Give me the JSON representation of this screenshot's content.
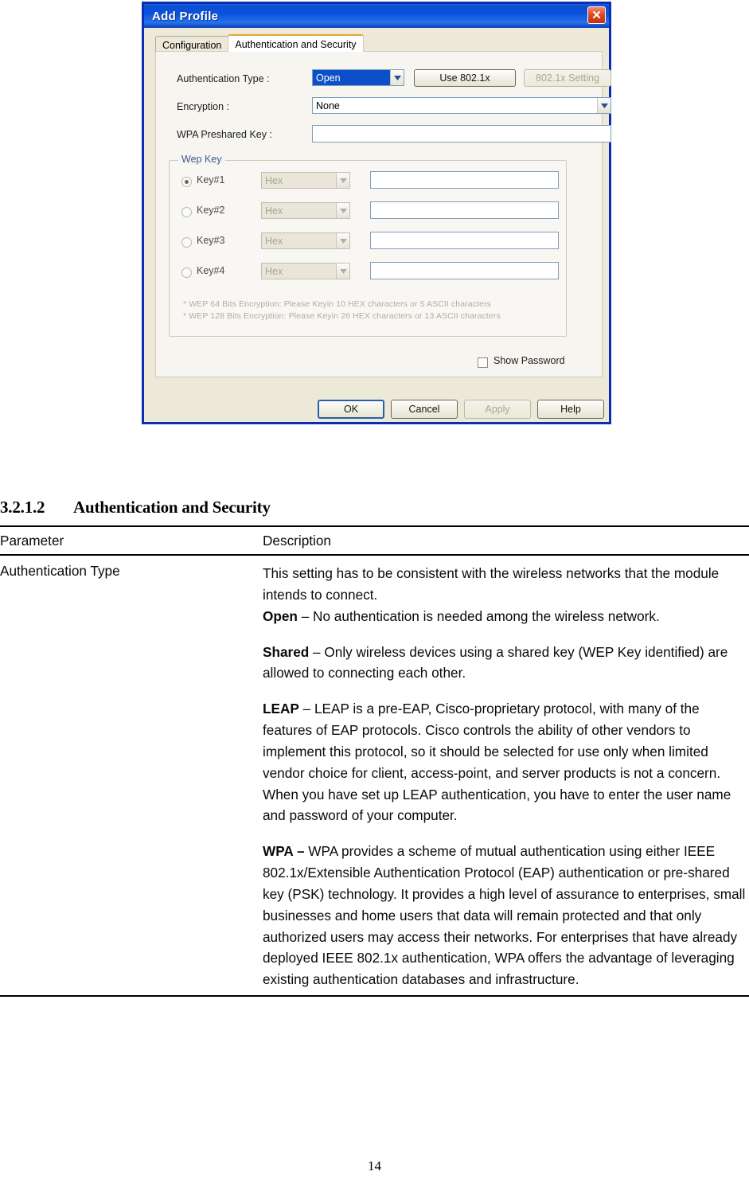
{
  "dialog": {
    "title": "Add Profile",
    "close_icon": "close-icon",
    "tabs": [
      {
        "label": "Configuration",
        "active": false
      },
      {
        "label": "Authentication and Security",
        "active": true
      }
    ],
    "fields": {
      "auth_type_label": "Authentication Type :",
      "auth_type_value": "Open",
      "use_8021x_label": "Use 802.1x",
      "setting_8021x_label": "802.1x Setting",
      "encryption_label": "Encryption :",
      "encryption_value": "None",
      "wpa_key_label": "WPA Preshared Key :",
      "wpa_key_value": ""
    },
    "wep_group": {
      "title": "Wep Key",
      "keys": [
        {
          "label": "Key#1",
          "selected": true,
          "format": "Hex",
          "value": ""
        },
        {
          "label": "Key#2",
          "selected": false,
          "format": "Hex",
          "value": ""
        },
        {
          "label": "Key#3",
          "selected": false,
          "format": "Hex",
          "value": ""
        },
        {
          "label": "Key#4",
          "selected": false,
          "format": "Hex",
          "value": ""
        }
      ],
      "hint_line_1": "* WEP 64 Bits Encryption:  Please Keyin 10 HEX characters or 5 ASCII characters",
      "hint_line_2": "* WEP 128 Bits Encryption:  Please Keyin 26 HEX characters or 13 ASCII characters"
    },
    "show_password_label": "Show Password",
    "show_password_checked": false,
    "buttons": {
      "ok": "OK",
      "cancel": "Cancel",
      "apply": "Apply",
      "help": "Help"
    },
    "colors": {
      "titlebar_blue": "#0a51dd",
      "dialog_border": "#0a2fb4",
      "face": "#ece9d8",
      "active_tab_accent": "#e9a43c",
      "selection_blue": "#0b4fc9",
      "close_red": "#c5300d"
    }
  },
  "document": {
    "section_number": "3.2.1.2",
    "section_title": "Authentication and Security",
    "table": {
      "headers": [
        "Parameter",
        "Description"
      ],
      "rows": [
        {
          "parameter": "Authentication Type",
          "description_paragraphs": [
            {
              "bold": "",
              "text": "This setting has to be consistent with the wireless networks that the module intends to connect.",
              "gap": false
            },
            {
              "bold": "Open",
              "text": " – No authentication is needed among the wireless network.",
              "gap": false
            },
            {
              "bold": "Shared",
              "text": " – Only wireless devices using a shared key (WEP Key identified) are allowed to connecting each other.",
              "gap": true
            },
            {
              "bold": "LEAP",
              "text": " – LEAP is a pre-EAP, Cisco-proprietary protocol, with many of the features of EAP protocols. Cisco controls the ability of other vendors to implement this protocol, so it should be selected for use only when limited vendor choice for client, access-point, and server products is not a concern. When you have set up LEAP authentication, you have to enter the user name and password of your computer.",
              "gap": true
            },
            {
              "bold": "WPA –",
              "text": " WPA provides a scheme of mutual authentication using either IEEE 802.1x/Extensible Authentication Protocol (EAP) authentication or pre-shared key (PSK) technology. It provides a high level of assurance to enterprises, small businesses and home users that data will remain protected and that only authorized users may access their networks. For enterprises that have already deployed IEEE 802.1x authentication, WPA offers the advantage of leveraging existing authentication databases and infrastructure.",
              "gap": true
            }
          ]
        }
      ]
    },
    "page_number": "14"
  }
}
